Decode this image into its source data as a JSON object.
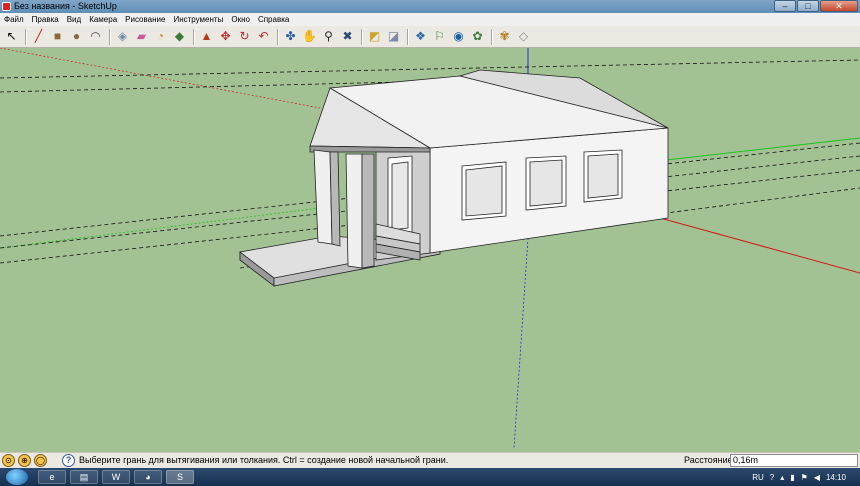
{
  "window": {
    "title": "Без названия - SketchUp",
    "controls": {
      "minimize": "–",
      "maximize": "□",
      "close": "✕"
    }
  },
  "menu": [
    "Файл",
    "Правка",
    "Вид",
    "Камера",
    "Рисование",
    "Инструменты",
    "Окно",
    "Справка"
  ],
  "toolbar": {
    "tools": [
      {
        "name": "select-tool-icon",
        "glyph": "↖",
        "color": "#000000"
      },
      {
        "name": "line-tool-icon",
        "glyph": "╱",
        "color": "#b32424"
      },
      {
        "name": "rectangle-tool-icon",
        "glyph": "■",
        "color": "#8a6a3a"
      },
      {
        "name": "circle-tool-icon",
        "glyph": "●",
        "color": "#8a6a3a"
      },
      {
        "name": "arc-tool-icon",
        "glyph": "◠",
        "color": "#444444"
      },
      {
        "name": "make-component-icon",
        "glyph": "◈",
        "color": "#6f8aa8"
      },
      {
        "name": "eraser-tool-icon",
        "glyph": "▰",
        "color": "#c65a9a"
      },
      {
        "name": "tape-measure-icon",
        "glyph": "◔",
        "color": "#c98a2a"
      },
      {
        "name": "paint-bucket-icon",
        "glyph": "◆",
        "color": "#3a7a3a"
      },
      {
        "name": "push-pull-icon",
        "glyph": "▲",
        "color": "#b53a1a"
      },
      {
        "name": "move-tool-icon",
        "glyph": "✥",
        "color": "#c42a2a"
      },
      {
        "name": "rotate-tool-icon",
        "glyph": "↻",
        "color": "#c42a2a"
      },
      {
        "name": "offset-tool-icon",
        "glyph": "↶",
        "color": "#c42a2a"
      },
      {
        "name": "orbit-tool-icon",
        "glyph": "✤",
        "color": "#2a5fb0"
      },
      {
        "name": "pan-tool-icon",
        "glyph": "✋",
        "color": "#6a6a6a"
      },
      {
        "name": "zoom-tool-icon",
        "glyph": "⚲",
        "color": "#2a2a2a"
      },
      {
        "name": "zoom-extents-icon",
        "glyph": "✖",
        "color": "#2a4a7a"
      },
      {
        "name": "get-models-icon",
        "glyph": "◩",
        "color": "#c9a52a"
      },
      {
        "name": "share-model-icon",
        "glyph": "◪",
        "color": "#7a8aa8"
      },
      {
        "name": "components-icon",
        "glyph": "❖",
        "color": "#2a6aa8"
      },
      {
        "name": "add-location-icon",
        "glyph": "⚐",
        "color": "#3a8a3a"
      },
      {
        "name": "google-earth-icon",
        "glyph": "◉",
        "color": "#1a5fa8"
      },
      {
        "name": "extension-warehouse-icon",
        "glyph": "✿",
        "color": "#3a7a3a"
      },
      {
        "name": "style-tool-icon",
        "glyph": "✾",
        "color": "#b57a1a"
      },
      {
        "name": "scenes-icon",
        "glyph": "◇",
        "color": "#8a8a8a"
      }
    ]
  },
  "status": {
    "icons": [
      "geo-location-icon",
      "credits-icon",
      "user-icon"
    ],
    "help_glyph": "?",
    "hint": "Выберите грань для вытягивания или толкания.  Ctrl = создание новой начальной грани.",
    "measure_label": "Расстояние",
    "measure_value": "0,16m"
  },
  "taskbar": {
    "apps": [
      {
        "name": "ie-icon",
        "glyph": "e"
      },
      {
        "name": "explorer-icon",
        "glyph": "▤"
      },
      {
        "name": "word-icon",
        "glyph": "W"
      },
      {
        "name": "chrome-icon",
        "glyph": "◕"
      },
      {
        "name": "sketchup-taskbar-icon",
        "glyph": "S"
      }
    ],
    "tray": {
      "language": "RU",
      "time": "14:10"
    }
  },
  "colors": {
    "ground": "#a3c294",
    "sky_area": "#a3c294",
    "red_axis": "#d11a1a",
    "green_axis": "#1ec21e",
    "blue_axis": "#2a2ad1"
  }
}
